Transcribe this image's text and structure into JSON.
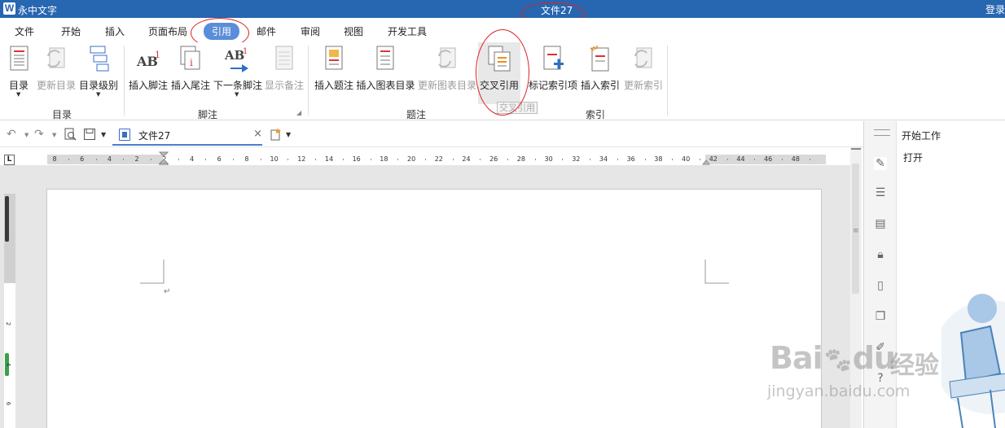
{
  "app": {
    "logo_letter": "W",
    "name": "永中文字",
    "document_title": "文件27",
    "login_label": "登录"
  },
  "menu": [
    {
      "label": "文件"
    },
    {
      "label": "开始"
    },
    {
      "label": "插入"
    },
    {
      "label": "页面布局"
    },
    {
      "label": "引用",
      "active": true
    },
    {
      "label": "邮件"
    },
    {
      "label": "审阅"
    },
    {
      "label": "视图"
    },
    {
      "label": "开发工具"
    }
  ],
  "ribbon": {
    "toc": {
      "label": "目录",
      "update": "更新目录",
      "level": "目录级别",
      "group": "目录"
    },
    "footnotes": {
      "insert_footnote": "插入脚注",
      "insert_endnote": "插入尾注",
      "next_footnote": "下一条脚注",
      "show_notes": "显示备注",
      "group": "脚注"
    },
    "captions": {
      "insert_caption": "插入题注",
      "insert_figure_toc": "插入图表目录",
      "update_figure_toc": "更新图表目录",
      "cross_reference": "交叉引用",
      "group": "题注"
    },
    "index": {
      "mark_entry": "标记索引项",
      "insert_index": "插入索引",
      "update_index": "更新索引",
      "group": "索引"
    },
    "tooltip": "交叉引用",
    "ab_text": "AB",
    "ab_sup": "1"
  },
  "doc_tab": {
    "title": "文件27",
    "close": "×"
  },
  "ruler": {
    "corner": "L",
    "ticks": [
      "8",
      "6",
      "4",
      "2",
      "2",
      "4",
      "6",
      "8",
      "10",
      "12",
      "14",
      "16",
      "18",
      "20",
      "22",
      "24",
      "26",
      "28",
      "30",
      "32",
      "34",
      "36",
      "38",
      "40",
      "42",
      "44",
      "46",
      "48"
    ],
    "vticks": [
      "2",
      "4",
      "6"
    ]
  },
  "task_pane": {
    "header": "开始工作",
    "open": "打开"
  },
  "watermark": {
    "brand": "Bai",
    "brand2": "du",
    "site": "经验",
    "url": "jingyan.baidu.com"
  },
  "colors": {
    "titlebar": "#2766b0",
    "active_tab": "#5b8ed9",
    "annotation": "#dd2222"
  }
}
